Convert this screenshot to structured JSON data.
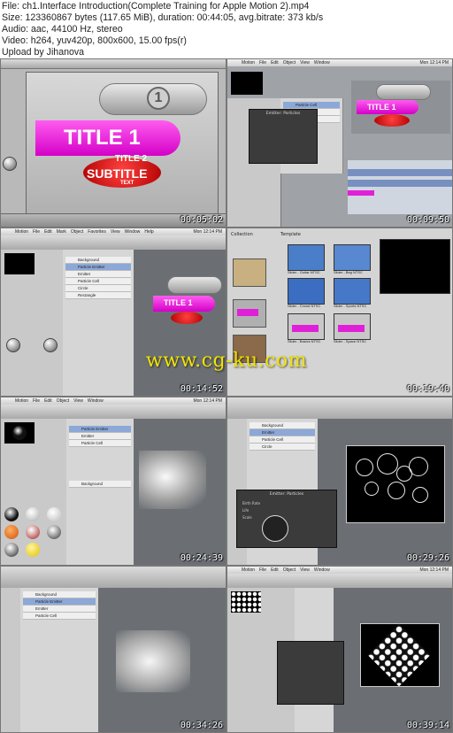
{
  "header": {
    "file_line": "File: ch1.Interface Introduction(Complete Training for Apple Motion 2).mp4",
    "size_line": "Size: 123360867 bytes (117.65 MiB), duration: 00:44:05, avg.bitrate: 373 kb/s",
    "audio_line": "Audio: aac, 44100 Hz, stereo",
    "video_line": "Video: h264, yuv420p, 800x600, 15.00 fps(r)",
    "upload_line": "Upload by Jihanova"
  },
  "watermark": "www.cg-ku.com",
  "app_menu": [
    "Motion",
    "File",
    "Edit",
    "Mark",
    "Object",
    "Favorites",
    "View",
    "Window",
    "Help"
  ],
  "clock": "Mon 12:14 PM",
  "title_graphic": {
    "number": "1",
    "title": "TITLE 1",
    "title2": "TITLE 2",
    "subtitle": "SUBTITLE",
    "text": "TEXT"
  },
  "thumbnails": [
    {
      "timestamp": "00:05:02"
    },
    {
      "timestamp": "00:09:50"
    },
    {
      "timestamp": "00:14:52"
    },
    {
      "timestamp": "00:19:40"
    },
    {
      "timestamp": "00:24:39"
    },
    {
      "timestamp": "00:29:26"
    },
    {
      "timestamp": "00:34:26"
    },
    {
      "timestamp": "00:39:14"
    }
  ],
  "layers": [
    "Background",
    "Particle Emitter",
    "Emitter",
    "Particle Cell",
    "Circle",
    "Rectangle"
  ],
  "dialog": {
    "title": "Emitter: Particles",
    "birth_rate": "Birth Rate",
    "life": "Life",
    "scale": "Scale"
  },
  "template_captions": [
    "Slider - Guitar NTSC",
    "Slider - Beg NTSC",
    "Slider - Crowd NTSC",
    "Slider - Sports NTSC",
    "Slider - Basics NTSC",
    "Slider - Space NTSC"
  ],
  "template_headers": {
    "collection": "Collection",
    "template": "Template"
  },
  "colors": {
    "pink": "#e81ee0",
    "red": "#d01010",
    "canvas": "#6b6f74",
    "watermark": "#f2e400"
  }
}
